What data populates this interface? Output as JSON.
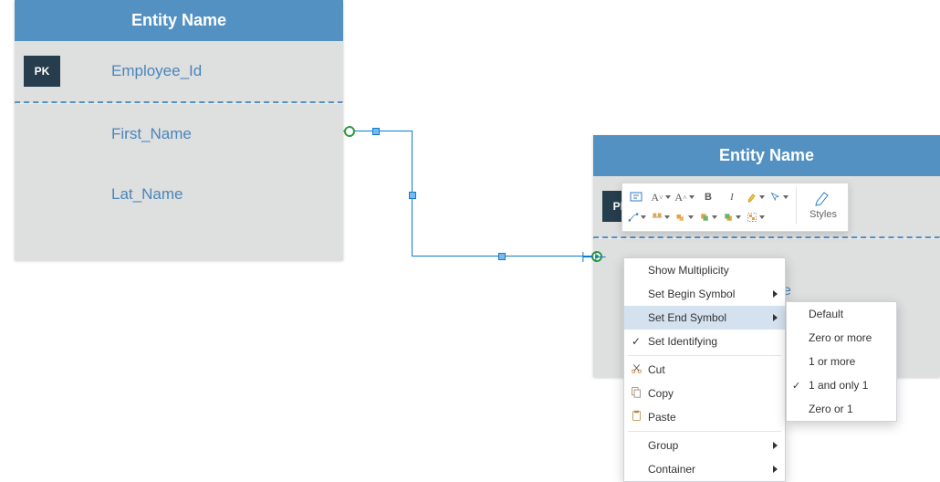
{
  "entities": [
    {
      "title": "Entity Name",
      "pk_label": "PK",
      "attrs": [
        "Employee_Id",
        "First_Name",
        "Lat_Name"
      ]
    },
    {
      "title": "Entity Name",
      "pk_label": "PK",
      "attrs": []
    }
  ],
  "connector": {
    "end_symbol_glyph": "⊢⊢"
  },
  "mini_toolbar": {
    "styles_label": "Styles",
    "items": [
      "text-box",
      "font-smaller",
      "font-larger",
      "bold",
      "italic",
      "format-painter",
      "pointer",
      "connector",
      "align",
      "arrange",
      "bring-front",
      "send-back",
      "group"
    ]
  },
  "context_menu": {
    "items": [
      {
        "label": "Show Multiplicity",
        "icon": "",
        "submenu": false
      },
      {
        "label": "Set Begin Symbol",
        "icon": "",
        "submenu": true
      },
      {
        "label": "Set End Symbol",
        "icon": "",
        "submenu": true,
        "highlight": true
      },
      {
        "label": "Set Identifying",
        "icon": "check",
        "submenu": false
      },
      {
        "label": "Cut",
        "icon": "cut",
        "submenu": false,
        "divider_before": true
      },
      {
        "label": "Copy",
        "icon": "copy",
        "submenu": false
      },
      {
        "label": "Paste",
        "icon": "paste",
        "submenu": false
      },
      {
        "label": "Group",
        "icon": "",
        "submenu": true,
        "divider_before": true
      },
      {
        "label": "Container",
        "icon": "",
        "submenu": true
      }
    ]
  },
  "submenu": {
    "items": [
      {
        "label": "Default",
        "checked": false
      },
      {
        "label": "Zero or more",
        "checked": false
      },
      {
        "label": "1 or more",
        "checked": false
      },
      {
        "label": "1 and only 1",
        "checked": true
      },
      {
        "label": "Zero or 1",
        "checked": false
      }
    ]
  },
  "stray_text": "e"
}
